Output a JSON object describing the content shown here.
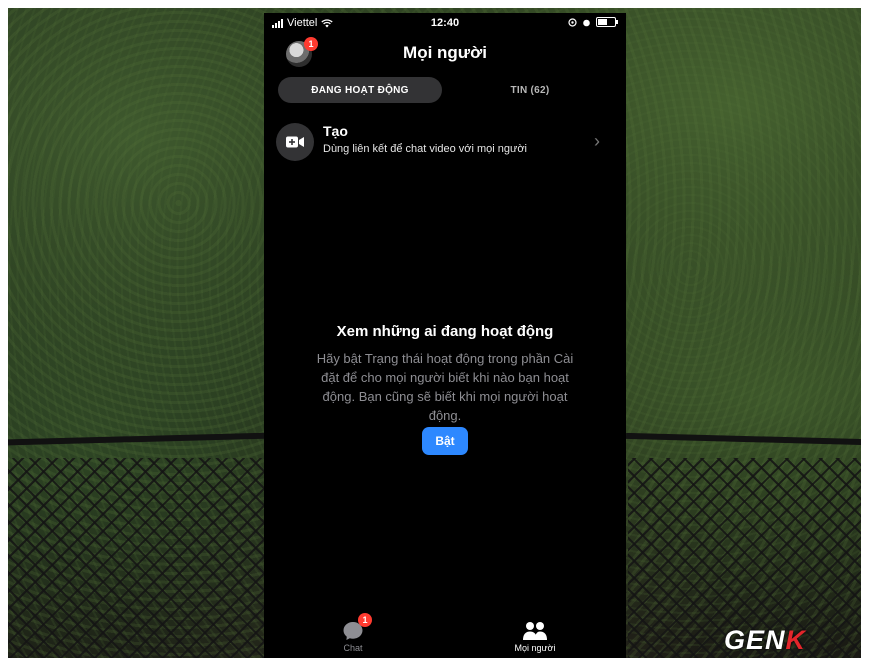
{
  "status_bar": {
    "carrier": "Viettel",
    "time": "12:40"
  },
  "header": {
    "title": "Mọi người",
    "avatar_badge": "1"
  },
  "tabs": [
    {
      "label": "ĐANG HOẠT ĐỘNG",
      "active": true
    },
    {
      "label": "TIN (62)",
      "active": false
    }
  ],
  "create_row": {
    "title": "Tạo",
    "subtitle": "Dùng liên kết để chat video với mọi người"
  },
  "empty_state": {
    "title": "Xem những ai đang hoạt động",
    "body": "Hãy bật Trạng thái hoạt động trong phần Cài đặt để cho mọi người biết khi nào bạn hoạt động. Bạn cũng sẽ biết khi mọi người hoạt động.",
    "button_label": "Bật"
  },
  "tab_bar": {
    "chat_label": "Chat",
    "chat_badge": "1",
    "people_label": "Mọi người"
  },
  "watermark": {
    "text_main": "GEN",
    "text_k": "K"
  },
  "colors": {
    "accent": "#2d88ff",
    "badge": "#ff3b30",
    "background": "#000000"
  }
}
